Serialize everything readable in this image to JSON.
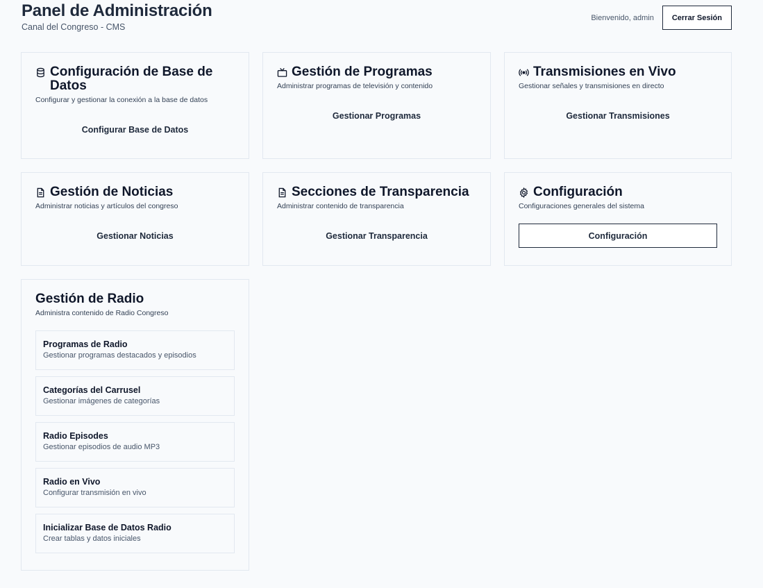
{
  "header": {
    "title": "Panel de Administración",
    "subtitle": "Canal del Congreso - CMS",
    "welcome": "Bienvenido, admin",
    "logout_label": "Cerrar Sesión"
  },
  "cards": [
    {
      "icon": "database-icon",
      "title": "Configuración de Base de Datos",
      "description": "Configurar y gestionar la conexión a la base de datos",
      "action": "Configurar Base de Datos"
    },
    {
      "icon": "tv-icon",
      "title": "Gestión de Programas",
      "description": "Administrar programas de televisión y contenido",
      "action": "Gestionar Programas"
    },
    {
      "icon": "broadcast-icon",
      "title": "Transmisiones en Vivo",
      "description": "Gestionar señales y transmisiones en directo",
      "action": "Gestionar Transmisiones"
    },
    {
      "icon": "document-icon",
      "title": "Gestión de Noticias",
      "description": "Administrar noticias y artículos del congreso",
      "action": "Gestionar Noticias"
    },
    {
      "icon": "document-icon",
      "title": "Secciones de Transparencia",
      "description": "Administrar contenido de transparencia",
      "action": "Gestionar Transparencia"
    },
    {
      "icon": "gear-icon",
      "title": "Configuración",
      "description": "Configuraciones generales del sistema",
      "action": "Configuración"
    }
  ],
  "radio": {
    "title": "Gestión de Radio",
    "description": "Administra contenido de Radio Congreso",
    "items": [
      {
        "title": "Programas de Radio",
        "description": "Gestionar programas destacados y episodios"
      },
      {
        "title": "Categorías del Carrusel",
        "description": "Gestionar imágenes de categorías"
      },
      {
        "title": "Radio Episodes",
        "description": "Gestionar episodios de audio MP3"
      },
      {
        "title": "Radio en Vivo",
        "description": "Configurar transmisión en vivo"
      },
      {
        "title": "Inicializar Base de Datos Radio",
        "description": "Crear tablas y datos iniciales"
      }
    ]
  }
}
